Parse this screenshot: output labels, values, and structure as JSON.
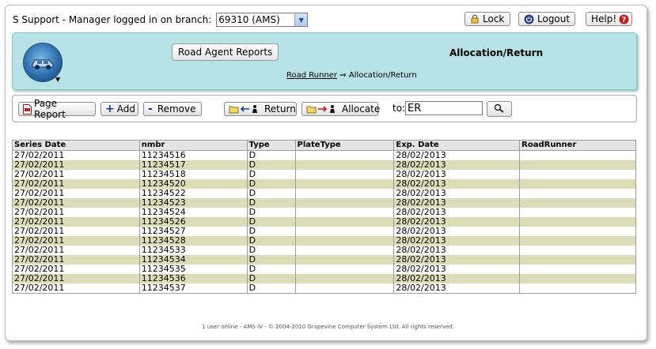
{
  "topbar": {
    "login_text": "S Support - Manager logged in on branch:",
    "branch_value": "69310 (AMS)",
    "lock_label": "Lock",
    "logout_label": "Logout",
    "help_label": "Help!"
  },
  "header": {
    "reports_button": "Road Agent Reports",
    "title": "Allocation/Return",
    "breadcrumb_link": "Road Runner",
    "breadcrumb_sep": "⇒",
    "breadcrumb_current": "Allocation/Return"
  },
  "toolbar": {
    "page_report": "Page Report",
    "add": "Add",
    "remove": "Remove",
    "return": "Return",
    "allocate": "Allocate",
    "to_label": "to:",
    "to_value": "ER"
  },
  "table": {
    "columns": [
      "Series Date",
      "nmbr",
      "Type",
      "PlateType",
      "Exp. Date",
      "RoadRunner"
    ],
    "rows": [
      [
        "27/02/2011",
        "11234516",
        "D",
        "",
        "28/02/2013",
        ""
      ],
      [
        "27/02/2011",
        "11234517",
        "D",
        "",
        "28/02/2013",
        ""
      ],
      [
        "27/02/2011",
        "11234518",
        "D",
        "",
        "28/02/2013",
        ""
      ],
      [
        "27/02/2011",
        "11234520",
        "D",
        "",
        "28/02/2013",
        ""
      ],
      [
        "27/02/2011",
        "11234522",
        "D",
        "",
        "28/02/2013",
        ""
      ],
      [
        "27/02/2011",
        "11234523",
        "D",
        "",
        "28/02/2013",
        ""
      ],
      [
        "27/02/2011",
        "11234524",
        "D",
        "",
        "28/02/2013",
        ""
      ],
      [
        "27/02/2011",
        "11234526",
        "D",
        "",
        "28/02/2013",
        ""
      ],
      [
        "27/02/2011",
        "11234527",
        "D",
        "",
        "28/02/2013",
        ""
      ],
      [
        "27/02/2011",
        "11234528",
        "D",
        "",
        "28/02/2013",
        ""
      ],
      [
        "27/02/2011",
        "11234533",
        "D",
        "",
        "28/02/2013",
        ""
      ],
      [
        "27/02/2011",
        "11234534",
        "D",
        "",
        "28/02/2013",
        ""
      ],
      [
        "27/02/2011",
        "11234535",
        "D",
        "",
        "28/02/2013",
        ""
      ],
      [
        "27/02/2011",
        "11234536",
        "D",
        "",
        "28/02/2013",
        ""
      ],
      [
        "27/02/2011",
        "11234537",
        "D",
        "",
        "28/02/2013",
        ""
      ]
    ]
  },
  "footer": "1 user online - AMS IV - © 2004-2010 Grapevine Computer System Ltd. All rights reserved.",
  "colors": {
    "header_bg": "#b7e3e6",
    "alt_row": "#dddcb8",
    "table_header": "#e5e5e5"
  },
  "icons": {
    "lock": "lock-icon",
    "logout": "power-icon",
    "help": "question-icon",
    "page_report": "pdf-icon",
    "add": "plus-icon",
    "remove": "minus-icon",
    "return": "folder-arrow-left-person-icon",
    "allocate": "folder-arrow-right-person-icon",
    "search": "magnifier-icon",
    "logo": "car-globe-logo"
  }
}
